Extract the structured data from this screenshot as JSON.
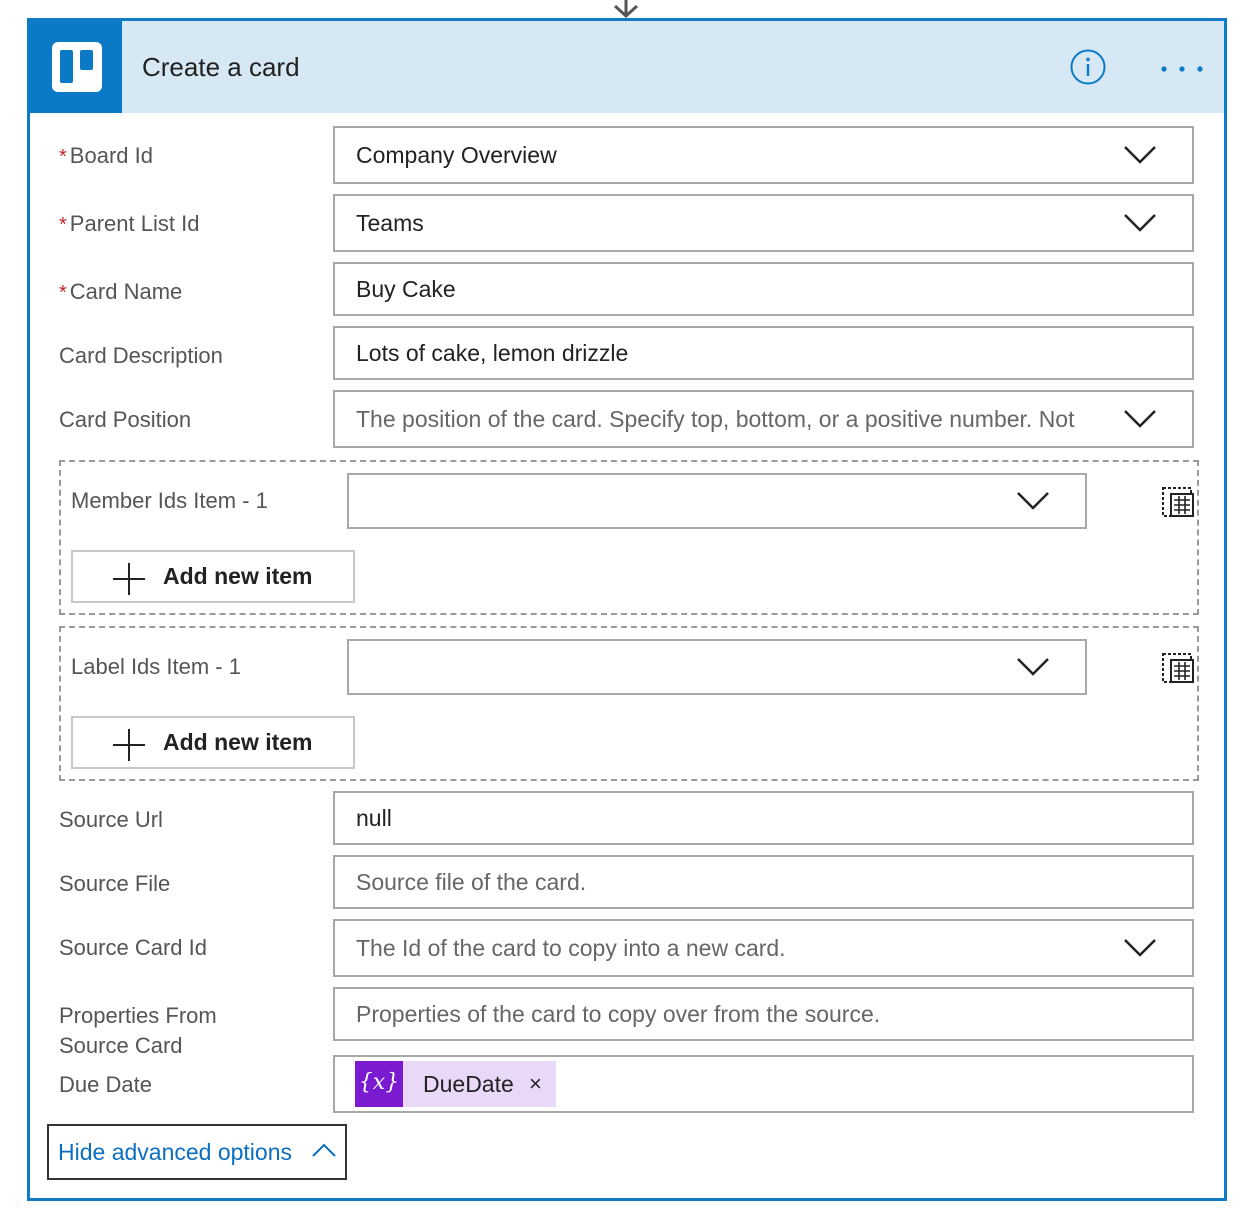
{
  "header": {
    "title": "Create a card",
    "logo_icon": "trello-icon",
    "info_icon": "info-icon",
    "more_icon": "more-icon",
    "accent": "#0f7bc4",
    "header_bg": "#d5e8f4"
  },
  "fields": {
    "board_id": {
      "label": "Board Id",
      "required": "*",
      "value": "Company Overview"
    },
    "parent_list_id": {
      "label": "Parent List Id",
      "required": "*",
      "value": "Teams"
    },
    "card_name": {
      "label": "Card Name",
      "required": "*",
      "value": "Buy Cake"
    },
    "card_description": {
      "label": "Card Description",
      "value": "Lots of cake, lemon drizzle"
    },
    "card_position": {
      "label": "Card Position",
      "placeholder": "The position of the card. Specify top, bottom, or a positive number. Not"
    },
    "source_url": {
      "label": "Source Url",
      "value": "null"
    },
    "source_file": {
      "label": "Source File",
      "placeholder": "Source file of the card."
    },
    "source_card_id": {
      "label": "Source Card Id",
      "placeholder": "The Id of the card to copy into a new card."
    },
    "properties_from_source": {
      "label_line1": "Properties From",
      "label_line2": "Source Card",
      "placeholder": "Properties of the card to copy over from the source."
    },
    "due_date": {
      "label": "Due Date",
      "token_symbol": "{x}",
      "token_name": "DueDate",
      "token_close": "×",
      "token_color": "#7b1bd1"
    }
  },
  "member_ids": {
    "label": "Member Ids Item - 1",
    "add_label": "Add new item"
  },
  "label_ids": {
    "label": "Label Ids Item - 1",
    "add_label": "Add new item"
  },
  "footer": {
    "hide_advanced_label": "Hide advanced options"
  }
}
